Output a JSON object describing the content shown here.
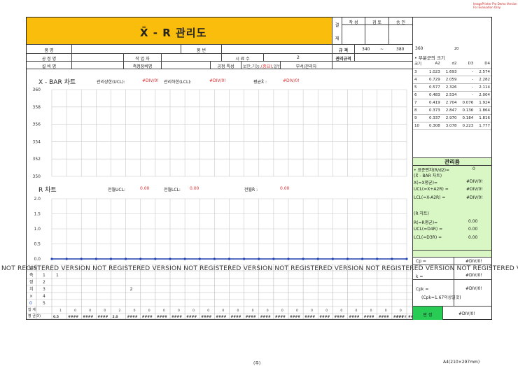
{
  "eval_notice": [
    "ImagePrinter Pro Demo Version",
    "For Evaluation Only"
  ],
  "title": "X̄ - R 관리도",
  "approval": {
    "side": [
      "결",
      "재"
    ],
    "labels": [
      "작 성",
      "검 토",
      "승 인"
    ]
  },
  "header": {
    "product_label": "품 명",
    "part_no_label": "품 번",
    "process_label": "공 정 명",
    "worker_label": "작 업 자",
    "sample_label": "시 료 수",
    "sample_value": "2",
    "equip_label": "설 비 명",
    "gauge_label": "측정장비명",
    "char_label": "공정 특성",
    "char_value_a": "보안,기능,",
    "char_value_b": "(중요)",
    "char_value_c": ",일반",
    "dept_label": "부서/관리자",
    "spec_label": "규 격",
    "spec_low": "340",
    "spec_dash": "~",
    "spec_high": "380",
    "control_spec_label": "관리규격"
  },
  "coef": {
    "top_value": "360",
    "top_small": "20",
    "title": "• 부분군의 크기",
    "headers": [
      "크기",
      "A2",
      "d2",
      "D3",
      "D4"
    ],
    "rows": [
      [
        "3",
        "1.023",
        "1.693",
        "-",
        "2.574"
      ],
      [
        "4",
        "0.729",
        "2.059",
        "-",
        "2.282"
      ],
      [
        "5",
        "0.577",
        "2.326",
        "-",
        "2.114"
      ],
      [
        "6",
        "0.483",
        "2.534",
        "-",
        "2.004"
      ],
      [
        "7",
        "0.419",
        "2.704",
        "0.076",
        "1.924"
      ],
      [
        "8",
        "0.373",
        "2.847",
        "0.136",
        "1.864"
      ],
      [
        "9",
        "0.337",
        "2.970",
        "0.184",
        "1.816"
      ],
      [
        "10",
        "0.308",
        "3.078",
        "0.223",
        "1.777"
      ]
    ]
  },
  "control": {
    "title": "관리용",
    "sigma_label": "• 표준편차(R/d2)=",
    "sigma_value": "0",
    "xbar_section": "(X̄ - BAR 차트)",
    "x_label": "X(=X평균)=",
    "x_value": "#DIV/0!",
    "ucl_label": "UCL(=X+A2R) =",
    "ucl_value": "#DIV/0!",
    "lcl_label": "LCL(=X-A2R) =",
    "lcl_value": "#DIV/0!",
    "r_section": "(R 차트)",
    "r_label": "R(=R평균)=",
    "r_value": "0.00",
    "rucl_label": "UCL(=D4R) =",
    "rucl_value": "0.00",
    "rlcl_label": "LCL(=D3R) =",
    "rlcl_value": "0.00",
    "cp_label": "Cp =",
    "cp_value": "#DIV/0!",
    "k_label": "k =",
    "k_value": "#DIV/0!",
    "cpk_label": "Cpk =",
    "cpk_value": "#DIV/0!",
    "cpk_note": "(Cpk=1.67이상일것)",
    "judge_label": "판 정",
    "judge_value": "#DIV/0!"
  },
  "xbar_header": {
    "title": "X - BAR 차트",
    "ucl_label": "관리상한(UCL):",
    "ucl_value": "#DIV/0!",
    "lcl_label": "관리하한(LCL):",
    "lcl_value": "#DIV/0!",
    "mean_label": "평균X̄ :",
    "mean_value": "#DIV/0!"
  },
  "r_header": {
    "title": "R 차트",
    "ucl_label": "전월UCL:",
    "ucl_value": "0.00",
    "lcl_label": "전월LCL:",
    "lcl_value": "0.00",
    "mean_label": "전월R̄ :",
    "mean_value": "0.00"
  },
  "watermark": "NOT REGISTERED VERSION NOT REGISTERED VERSION NOT REGISTERED VERSION NOT REGISTERED VERSION NOT REGISTERED VERSION NOT REGISTERED VERSION NOT REGISTERED V",
  "meas": {
    "row_labels": [
      "1",
      "2",
      "3",
      "4",
      "5"
    ],
    "side_labels": [
      "일자",
      "측",
      "정",
      "치",
      "×",
      "0"
    ],
    "cell_1": "1",
    "cell_2": "2",
    "sum_label": "합 계",
    "avg_label": "평 균(X̄)",
    "range_label": "범 위(R)",
    "sum_values": [
      "1",
      "0",
      "0",
      "0",
      "2",
      "0",
      "0",
      "0",
      "0",
      "0",
      "0",
      "0",
      "0",
      "0",
      "0",
      "0",
      "0",
      "0",
      "0",
      "0",
      "0",
      "0",
      "0",
      "0",
      "0"
    ],
    "avg_first": "0.5",
    "avg_third": "2.0",
    "avg_other": "####",
    "avg_last": "####",
    "range_first": "0.00",
    "range_values": "0.00",
    "range_last": "0.0"
  },
  "footer": {
    "center": "(주)",
    "right": "A4(210×297mm)"
  },
  "chart_data": [
    {
      "type": "line",
      "title": "X - BAR 차트",
      "ylim": [
        350,
        360
      ],
      "yticks": [
        "360",
        "358",
        "356",
        "354",
        "352",
        "350"
      ],
      "grid": true,
      "series": []
    },
    {
      "type": "line",
      "title": "R 차트",
      "ylim": [
        0.0,
        2.0
      ],
      "yticks": [
        "2.0",
        "1.5",
        "1.0",
        "0.5",
        "0.0"
      ],
      "grid": true,
      "series": [
        {
          "values": [
            0,
            0,
            0,
            0,
            0,
            0,
            0,
            0,
            0,
            0,
            0,
            0,
            0,
            0,
            0,
            0,
            0,
            0,
            0,
            0,
            0,
            0,
            0,
            0,
            0
          ],
          "color": "#1f3fae"
        }
      ]
    }
  ]
}
